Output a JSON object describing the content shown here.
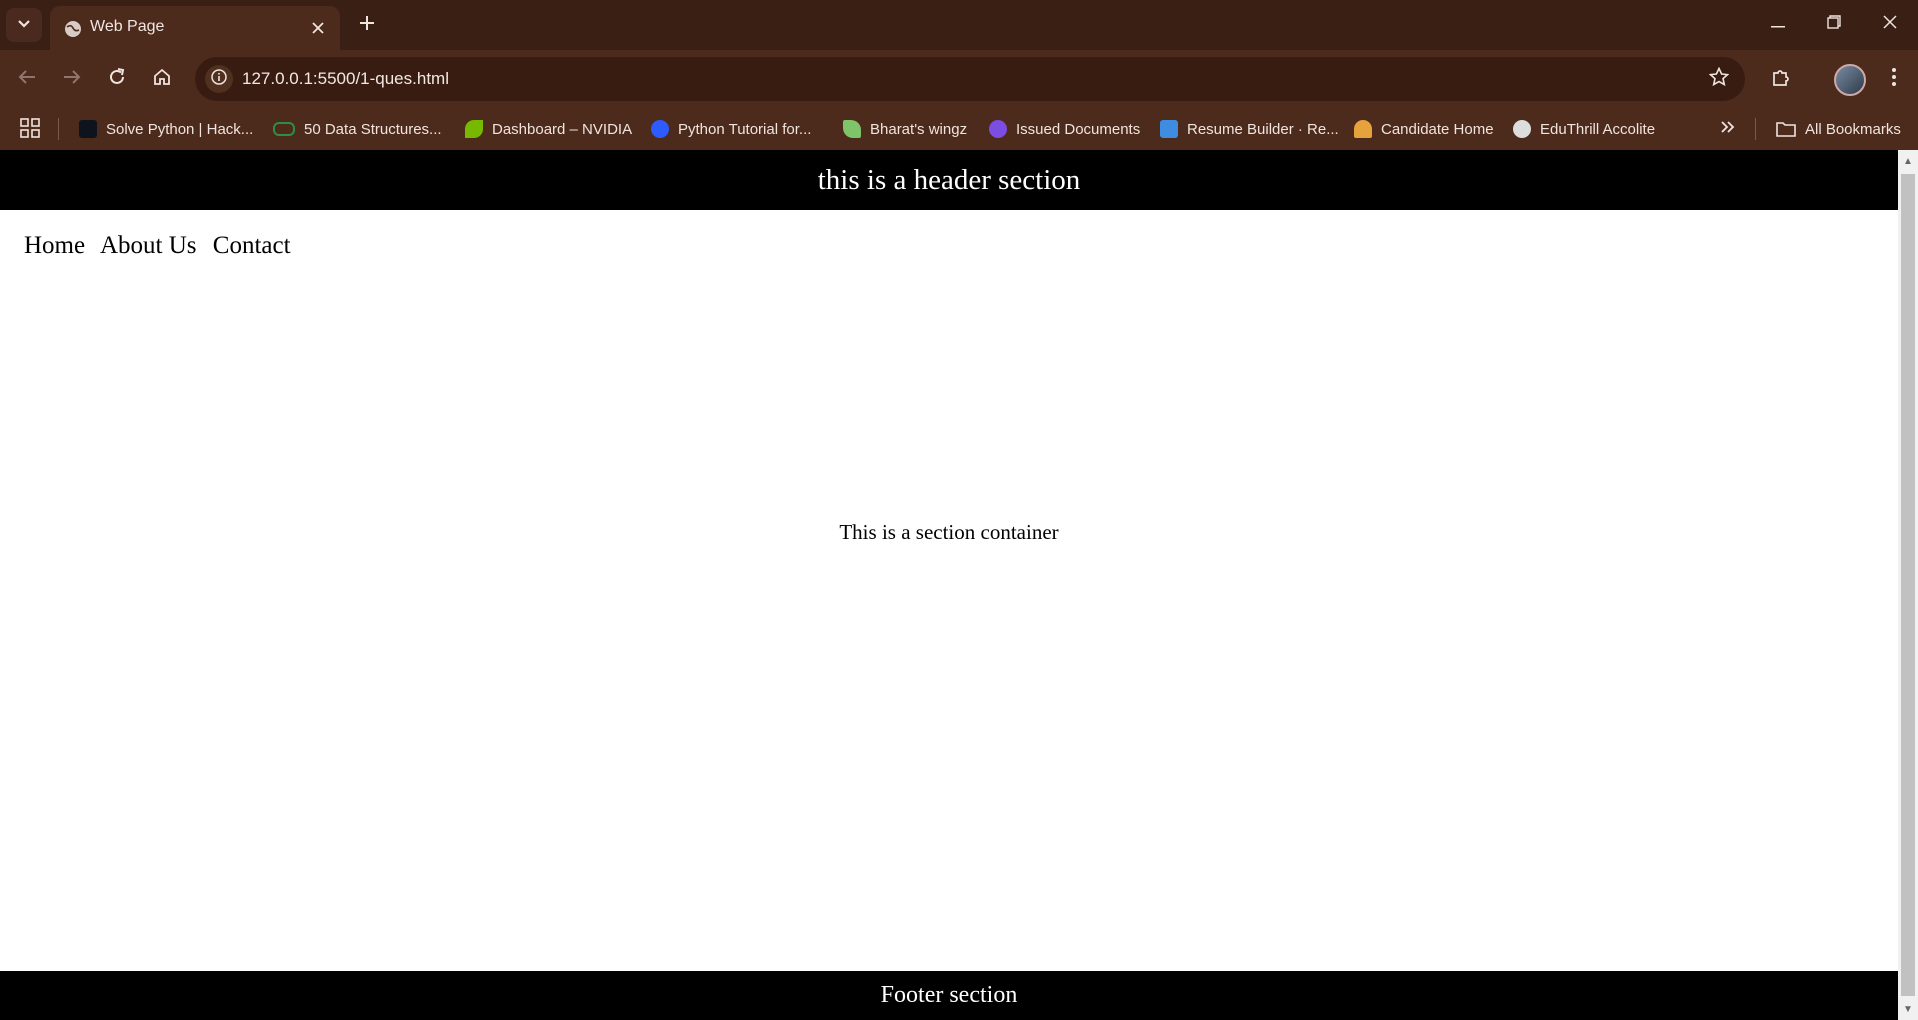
{
  "browser": {
    "tab_title": "Web Page",
    "url": "127.0.0.1:5500/1-ques.html",
    "bookmarks": [
      {
        "label": "Solve Python | Hack...",
        "icon": "hackerrank-icon",
        "color": "#1ba94c"
      },
      {
        "label": "50 Data Structures...",
        "icon": "geeksforgeeks-icon",
        "color": "#2f8d46"
      },
      {
        "label": "Dashboard – NVIDIA",
        "icon": "nvidia-icon",
        "color": "#76b900"
      },
      {
        "label": "Python Tutorial for...",
        "icon": "python-tutorial-icon",
        "color": "#2e5bff"
      },
      {
        "label": "Bharat's wingz",
        "icon": "wingz-icon",
        "color": "#7fc36b"
      },
      {
        "label": "Issued Documents",
        "icon": "digilocker-icon",
        "color": "#7b4de0"
      },
      {
        "label": "Resume Builder · Re...",
        "icon": "resume-builder-icon",
        "color": "#3e8de0"
      },
      {
        "label": "Candidate Home",
        "icon": "candidate-home-icon",
        "color": "#e6a23c"
      },
      {
        "label": "EduThrill Accolite",
        "icon": "eduthrill-icon",
        "color": "#dddddd"
      }
    ],
    "all_bookmarks_label": "All Bookmarks"
  },
  "page": {
    "header_text": "this is a header section",
    "nav_links": [
      "Home",
      "About Us",
      "Contact"
    ],
    "section_text": "This is a section container",
    "footer_text": "Footer section"
  },
  "colors": {
    "chrome_bg": "#3a1f15",
    "toolbar_bg": "#4c2a1c",
    "page_header_bg": "#000000",
    "page_footer_bg": "#000000"
  }
}
